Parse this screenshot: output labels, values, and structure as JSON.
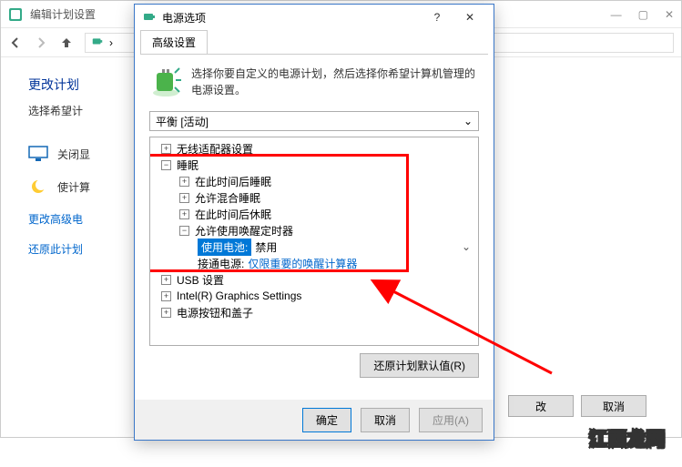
{
  "back_window": {
    "title": "编辑计划设置",
    "heading": "更改计划",
    "sub": "选择希望计",
    "row_display": "关闭显",
    "row_sleep": "使计算",
    "link_adv": "更改高级电",
    "link_restore": "还原此计划",
    "btn_cancel": "取消",
    "btn_change_partial": "改"
  },
  "dialog": {
    "title": "电源选项",
    "tab": "高级设置",
    "desc": "选择你要自定义的电源计划，然后选择你希望计算机管理的电源设置。",
    "plan_selected": "平衡 [活动]",
    "tree": {
      "wireless": "无线适配器设置",
      "sleep": "睡眠",
      "sleep_after": "在此时间后睡眠",
      "hybrid": "允许混合睡眠",
      "hibernate_after": "在此时间后休眠",
      "wake_timers": "允许使用唤醒定时器",
      "battery_label": "使用电池:",
      "battery_value": "禁用",
      "plugged_label": "接通电源:",
      "plugged_value": "仅限重要的唤醒计算器",
      "usb": "USB 设置",
      "graphics": "Intel(R) Graphics Settings",
      "power_buttons": "电源按钮和盖子"
    },
    "restore_defaults": "还原计划默认值(R)",
    "ok": "确定",
    "cancel": "取消",
    "apply": "应用(A)"
  },
  "watermark": "江西龙网",
  "colors": {
    "highlight": "#ff0000",
    "selection": "#0078d7",
    "link": "#0066cc"
  }
}
